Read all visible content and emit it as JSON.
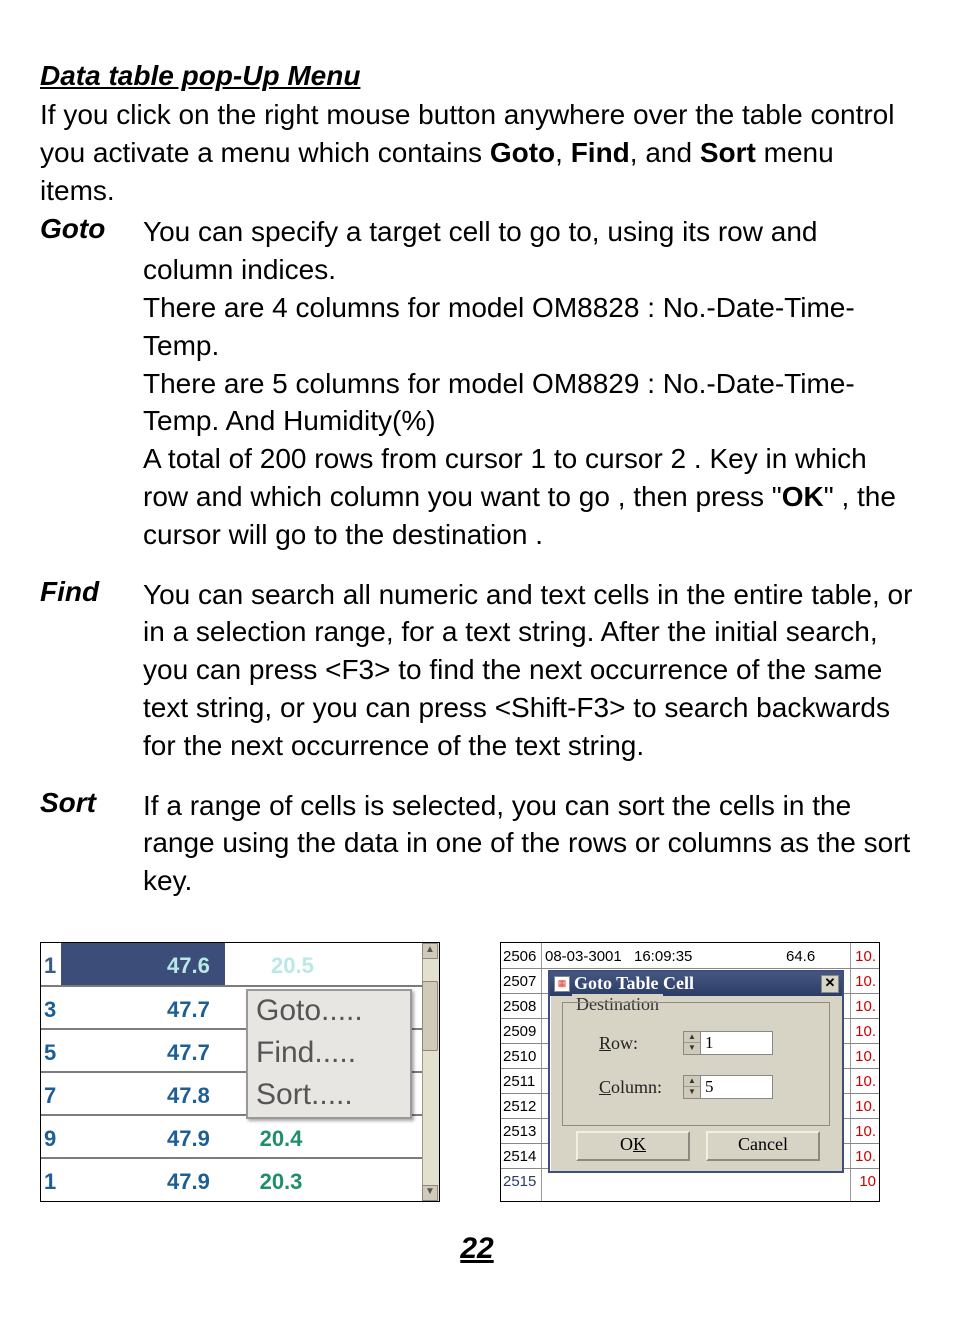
{
  "heading": "Data table pop-Up Menu",
  "intro_pre": "If you click on the right mouse button anywhere over the table control you activate a menu which contains ",
  "intro_b1": "Goto",
  "intro_sep1": ", ",
  "intro_b2": "Find",
  "intro_sep2": ", and ",
  "intro_b3": "Sort",
  "intro_post": " menu items.",
  "goto": {
    "label": "Goto",
    "line1": "You can specify a target cell to go to, using its row and column indices.",
    "line2": "There are 4 columns for model OM8828 : No.-Date-Time-Temp.",
    "line3": "There are 5 columns for model OM8829 : No.-Date-Time-Temp. And Humidity(%)",
    "line4_pre": "A total of 200 rows from cursor 1 to cursor 2 . Key in which row and which column you want to go , then press \"",
    "line4_ok": "OK",
    "line4_post": "\" , the cursor will go to the destination ."
  },
  "find": {
    "label": "Find",
    "body": "You can search all numeric and text cells in the entire table, or in a selection range, for a text string. After the initial search, you can press <F3> to find the next occurrence of the same text string, or you can press <Shift-F3> to search backwards for the next occurrence of the text string."
  },
  "sort": {
    "label": "Sort",
    "body": "If a range of cells is selected, you can sort the cells in the range using the data in one of the rows or columns as the sort key."
  },
  "left_fig": {
    "rows": [
      {
        "idx": "1",
        "v1": "47.6",
        "v2": "20.5"
      },
      {
        "idx": "3",
        "v1": "47.7",
        "v2": ""
      },
      {
        "idx": "5",
        "v1": "47.7",
        "v2": ""
      },
      {
        "idx": "7",
        "v1": "47.8",
        "v2": ""
      },
      {
        "idx": "9",
        "v1": "47.9",
        "v2": "20.4"
      },
      {
        "idx": "1",
        "v1": "47.9",
        "v2": "20.3"
      }
    ],
    "menu": {
      "goto": "Goto.....",
      "find": "Find.....",
      "sort": "Sort....."
    }
  },
  "right_fig": {
    "toprow": {
      "idx": "2506",
      "date": "08-03-3001",
      "time": "16:09:35",
      "val": "64.6",
      "last": "10."
    },
    "idx": [
      "2507",
      "2508",
      "2509",
      "2510",
      "2511",
      "2512",
      "2513",
      "2514"
    ],
    "last": "10.",
    "bottom_idx": "2515",
    "bottom_last": "10"
  },
  "dialog": {
    "title": "Goto Table Cell",
    "group": "Destination",
    "row_accel": "R",
    "row_rest": "ow:",
    "row_val": "1",
    "col_accel": "C",
    "col_rest": "olumn:",
    "col_val": "5",
    "ok_pre": "O",
    "ok_accel": "K",
    "cancel": "Cancel"
  },
  "page_number": "22"
}
